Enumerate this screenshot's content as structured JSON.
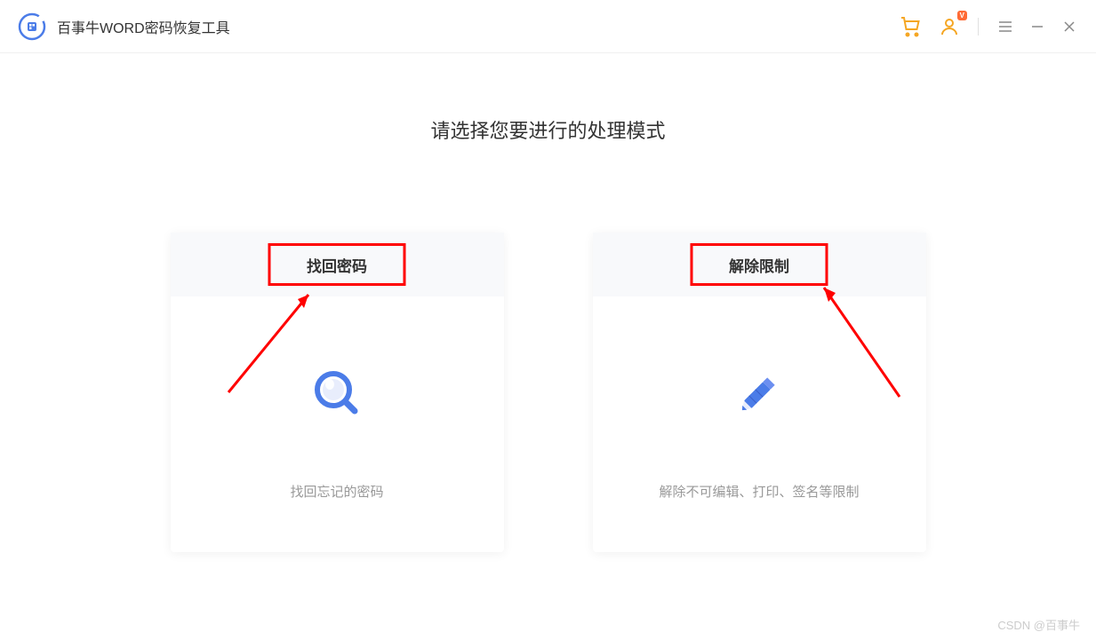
{
  "app": {
    "title": "百事牛WORD密码恢复工具"
  },
  "header": {
    "vip_badge": "V"
  },
  "main": {
    "heading": "请选择您要进行的处理模式"
  },
  "cards": [
    {
      "title": "找回密码",
      "description": "找回忘记的密码"
    },
    {
      "title": "解除限制",
      "description": "解除不可编辑、打印、签名等限制"
    }
  ],
  "watermark": "CSDN @百事牛",
  "colors": {
    "accent_orange": "#f5a623",
    "accent_blue": "#4b7ce8",
    "highlight_red": "#ff0000"
  }
}
